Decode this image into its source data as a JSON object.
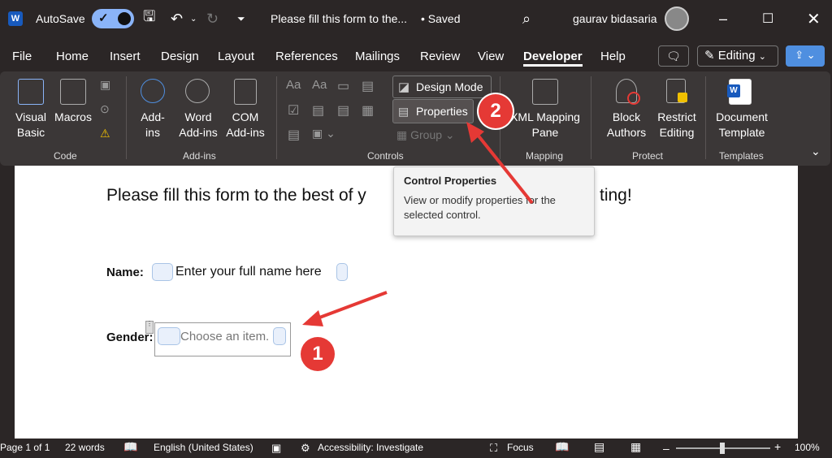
{
  "titlebar": {
    "autosave_label": "AutoSave",
    "doc_title": "Please fill this form to the...",
    "saved_status": "• Saved",
    "user_name": "gaurav bidasaria",
    "word_icon": "W"
  },
  "menu": {
    "tabs": [
      "File",
      "Home",
      "Insert",
      "Design",
      "Layout",
      "References",
      "Mailings",
      "Review",
      "View",
      "Developer",
      "Help"
    ],
    "active": "Developer",
    "editing_label": "Editing"
  },
  "ribbon": {
    "code": {
      "label": "Code",
      "visual_basic": "Visual\nBasic",
      "macros": "Macros"
    },
    "addins": {
      "label": "Add-ins",
      "addins_btn": "Add-\nins",
      "word_addins": "Word\nAdd-ins",
      "com_addins": "COM\nAdd-ins"
    },
    "controls": {
      "label": "Controls",
      "design_mode": "Design Mode",
      "properties": "Properties",
      "group": "Group"
    },
    "mapping": {
      "label": "Mapping",
      "xml_pane": "XML Mapping\nPane"
    },
    "protect": {
      "label": "Protect",
      "block_authors": "Block\nAuthors",
      "restrict_editing": "Restrict\nEditing"
    },
    "templates": {
      "label": "Templates",
      "document_template": "Document\nTemplate"
    }
  },
  "tooltip": {
    "title": "Control Properties",
    "description": "View or modify properties for the selected control."
  },
  "document": {
    "heading_left": "Please fill this form to the best of y",
    "heading_right": "ting!",
    "name_label": "Name:",
    "name_placeholder": "Enter your full name here",
    "gender_label": "Gender:",
    "gender_placeholder": "Choose an item."
  },
  "annotations": {
    "badge1": "1",
    "badge2": "2",
    "color": "#e53935"
  },
  "statusbar": {
    "page": "Page 1 of 1",
    "words": "22 words",
    "language": "English (United States)",
    "accessibility": "Accessibility: Investigate",
    "focus": "Focus",
    "zoom": "100%"
  }
}
